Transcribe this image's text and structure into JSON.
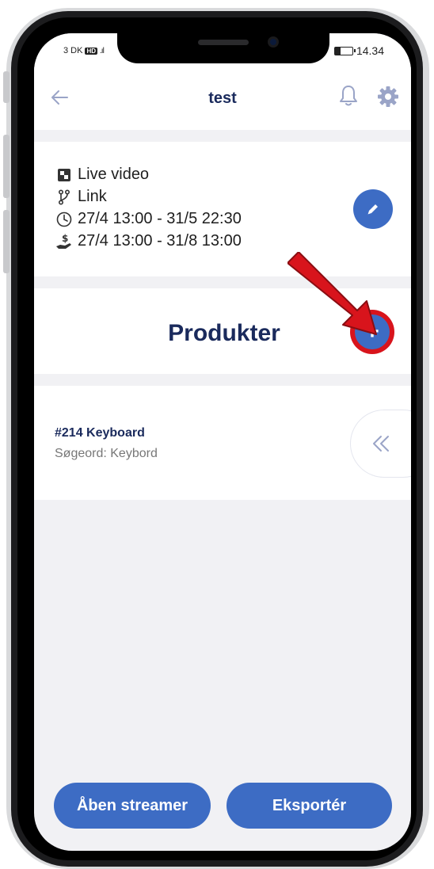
{
  "status_bar": {
    "carrier": "3 DK",
    "network_badge": "HD",
    "time": "14.34",
    "battery_level": 0.3
  },
  "header": {
    "title": "test",
    "back_icon": "arrow-left-icon",
    "notifications_icon": "bell-icon",
    "settings_icon": "gear-icon"
  },
  "event": {
    "type": "Live video",
    "access": "Link",
    "period": "27/4 13:00 - 31/5 22:30",
    "sales_period": "27/4 13:00 - 31/8 13:00",
    "edit_icon": "pencil-icon"
  },
  "products": {
    "title": "Produkter",
    "add_label": "+",
    "items": [
      {
        "name": "#214 Keyboard",
        "keywords": "Søgeord: Keybord"
      }
    ]
  },
  "actions": {
    "open_streamer": "Åben streamer",
    "export": "Eksportér"
  },
  "colors": {
    "primary": "#3d6cc4",
    "title_text": "#1a2a5c",
    "highlight": "#d8141c",
    "background": "#f1f1f4"
  }
}
